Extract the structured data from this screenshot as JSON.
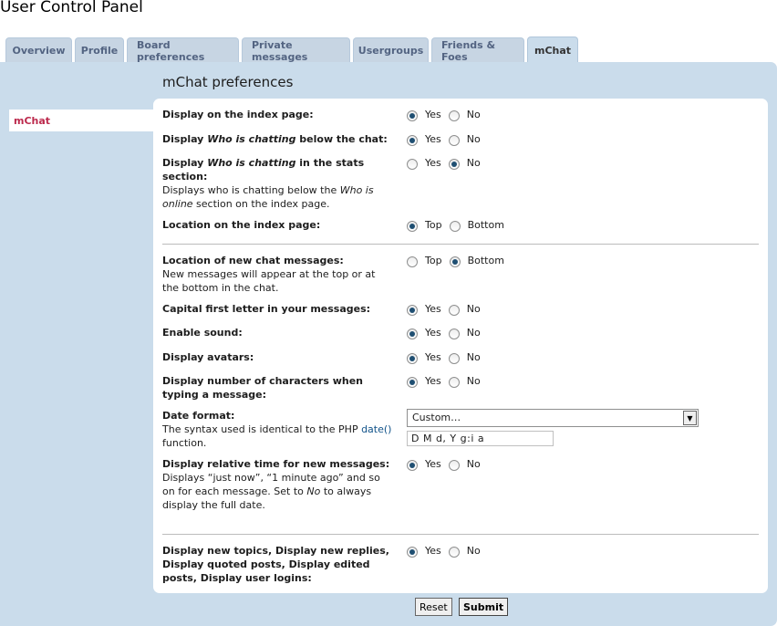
{
  "page": {
    "title": "User Control Panel"
  },
  "tabs": [
    {
      "label": "Overview"
    },
    {
      "label": "Profile"
    },
    {
      "label": "Board preferences"
    },
    {
      "label": "Private messages"
    },
    {
      "label": "Usergroups"
    },
    {
      "label": "Friends & Foes"
    },
    {
      "label": "mChat"
    }
  ],
  "sidebar": {
    "active_item": "mChat"
  },
  "section": {
    "title": "mChat preferences"
  },
  "prefs": {
    "index_page": {
      "title": "Display on the index page:",
      "opt1": "Yes",
      "opt2": "No",
      "selected": "Yes"
    },
    "who_chatting_below": {
      "t1": "Display ",
      "t2": "Who is chatting",
      "t3": " below the chat:",
      "opt1": "Yes",
      "opt2": "No",
      "selected": "Yes"
    },
    "who_chatting_stats": {
      "t1": "Display ",
      "t2": "Who is chatting",
      "t3": " in the stats section:",
      "d1": "Displays who is chatting below the ",
      "d2": "Who is online",
      "d3": " section on the index page.",
      "opt1": "Yes",
      "opt2": "No",
      "selected": "No"
    },
    "location_index": {
      "title": "Location on the index page:",
      "opt1": "Top",
      "opt2": "Bottom",
      "selected": "Top"
    },
    "location_new": {
      "title": "Location of new chat messages:",
      "desc": "New messages will appear at the top or at the bottom in the chat.",
      "opt1": "Top",
      "opt2": "Bottom",
      "selected": "Bottom"
    },
    "capital_first": {
      "title": "Capital first letter in your messages:",
      "opt1": "Yes",
      "opt2": "No",
      "selected": "Yes"
    },
    "sound": {
      "title": "Enable sound:",
      "opt1": "Yes",
      "opt2": "No",
      "selected": "Yes"
    },
    "avatars": {
      "title": "Display avatars:",
      "opt1": "Yes",
      "opt2": "No",
      "selected": "Yes"
    },
    "char_count": {
      "title": "Display number of characters when typing a message:",
      "opt1": "Yes",
      "opt2": "No",
      "selected": "Yes"
    },
    "date_format": {
      "title": "Date format:",
      "d1": "The syntax used is identical to the PHP ",
      "link": "date()",
      "d2": " function.",
      "select_value": "Custom…",
      "input_value": "D M d, Y g:i a"
    },
    "relative_time": {
      "title": "Display relative time for new messages:",
      "d1": "Displays “just now”, “1 minute ago” and so on for each message. Set to ",
      "d2": "No",
      "d3": " to always display the full date.",
      "opt1": "Yes",
      "opt2": "No",
      "selected": "Yes"
    },
    "notifications": {
      "title": "Display new topics, Display new replies, Display quoted posts, Display edited posts, Display user logins:",
      "opt1": "Yes",
      "opt2": "No",
      "selected": "Yes"
    }
  },
  "buttons": {
    "reset": "Reset",
    "submit": "Submit"
  }
}
